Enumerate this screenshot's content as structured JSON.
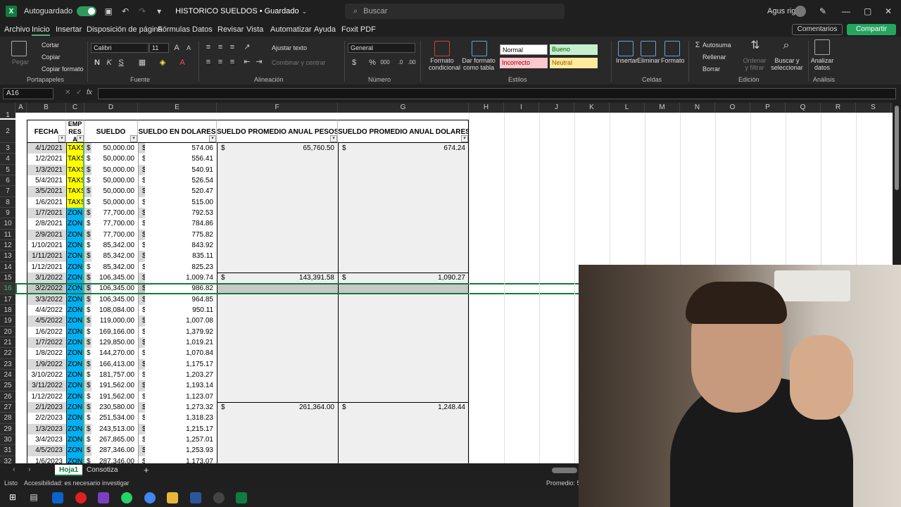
{
  "titlebar": {
    "autosave_label": "Autoguardado",
    "doc_title": "HISTORICO SUELDOS • Guardado",
    "search_placeholder": "Buscar",
    "user_name": "Agus riga"
  },
  "menu": {
    "items": [
      "Archivo",
      "Inicio",
      "Insertar",
      "Disposición de página",
      "Fórmulas",
      "Datos",
      "Revisar",
      "Vista",
      "Automatizar",
      "Ayuda",
      "Foxit PDF"
    ],
    "active": "Inicio",
    "comments": "Comentarios",
    "share": "Compartir"
  },
  "ribbon": {
    "clipboard": {
      "paste": "Pegar",
      "cut": "Cortar",
      "copy": "Copiar",
      "format_painter": "Copiar formato",
      "label": "Portapapeles"
    },
    "font": {
      "family": "Calibri",
      "size": "11",
      "bold": "N",
      "italic": "K",
      "underline": "S",
      "label": "Fuente"
    },
    "alignment": {
      "wrap": "Ajustar texto",
      "merge": "Combinar y centrar",
      "label": "Alineación"
    },
    "number": {
      "format": "General",
      "label": "Número"
    },
    "styles": {
      "cond_format": "Formato condicional",
      "table_format": "Dar formato como tabla",
      "normal": "Normal",
      "good": "Bueno",
      "bad": "Incorrecto",
      "neutral": "Neutral",
      "label": "Estilos"
    },
    "cells": {
      "insert": "Insertar",
      "delete": "Eliminar",
      "format": "Formato",
      "label": "Celdas"
    },
    "editing": {
      "autosum": "Autosuma",
      "fill": "Rellenar",
      "clear": "Borrar",
      "sort": "Ordenar y filtrar",
      "find": "Buscar y seleccionar",
      "label": "Edición"
    },
    "analysis": {
      "analyze": "Analizar datos",
      "label": "Análisis"
    }
  },
  "formula_bar": {
    "name_box": "A16",
    "fx": "fx",
    "content": ""
  },
  "columns": [
    "A",
    "B",
    "C",
    "D",
    "E",
    "F",
    "G",
    "H",
    "I",
    "J",
    "K",
    "L",
    "M",
    "N",
    "O",
    "P",
    "Q",
    "R",
    "S"
  ],
  "table": {
    "headers": {
      "fecha": "FECHA",
      "empresa_top": "EMP",
      "empresa_mid": "RES",
      "empresa_bot": "A",
      "sueldo": "SUELDO",
      "sueldo_usd": "SUELDO EN DOLARES",
      "prom_pesos": "SUELDO PROMEDIO ANUAL PESOS",
      "prom_usd": "SUELDO PROMEDIO ANUAL DOLARES"
    },
    "rows": [
      {
        "row": "3",
        "fecha": "4/1/2021",
        "emp": "TAXS",
        "sueldo": "50,000.00",
        "usd": "574.06",
        "prom_pesos": "65,760.50",
        "prom_usd": "674.24"
      },
      {
        "row": "4",
        "fecha": "1/2/2021",
        "emp": "TAXS",
        "sueldo": "50,000.00",
        "usd": "556.41"
      },
      {
        "row": "5",
        "fecha": "1/3/2021",
        "emp": "TAXS",
        "sueldo": "50,000.00",
        "usd": "540.91"
      },
      {
        "row": "6",
        "fecha": "5/4/2021",
        "emp": "TAXS",
        "sueldo": "50,000.00",
        "usd": "526.54"
      },
      {
        "row": "7",
        "fecha": "3/5/2021",
        "emp": "TAXS",
        "sueldo": "50,000.00",
        "usd": "520.47"
      },
      {
        "row": "8",
        "fecha": "1/6/2021",
        "emp": "TAXS",
        "sueldo": "50,000.00",
        "usd": "515.00"
      },
      {
        "row": "9",
        "fecha": "1/7/2021",
        "emp": "ZONI",
        "sueldo": "77,700.00",
        "usd": "792.53"
      },
      {
        "row": "10",
        "fecha": "2/8/2021",
        "emp": "ZONI",
        "sueldo": "77,700.00",
        "usd": "784.86"
      },
      {
        "row": "11",
        "fecha": "2/9/2021",
        "emp": "ZONI",
        "sueldo": "77,700.00",
        "usd": "775.82"
      },
      {
        "row": "12",
        "fecha": "1/10/2021",
        "emp": "ZONI",
        "sueldo": "85,342.00",
        "usd": "843.92"
      },
      {
        "row": "13",
        "fecha": "1/11/2021",
        "emp": "ZONI",
        "sueldo": "85,342.00",
        "usd": "835.11"
      },
      {
        "row": "14",
        "fecha": "1/12/2021",
        "emp": "ZONI",
        "sueldo": "85,342.00",
        "usd": "825.23"
      },
      {
        "row": "15",
        "fecha": "3/1/2022",
        "emp": "ZONI",
        "sueldo": "106,345.00",
        "usd": "1,009.74",
        "prom_pesos": "143,391.58",
        "prom_usd": "1,090.27"
      },
      {
        "row": "16",
        "fecha": "3/2/2022",
        "emp": "ZONI",
        "sueldo": "106,345.00",
        "usd": "986.82"
      },
      {
        "row": "17",
        "fecha": "3/3/2022",
        "emp": "ZONI",
        "sueldo": "106,345.00",
        "usd": "964.85"
      },
      {
        "row": "18",
        "fecha": "4/4/2022",
        "emp": "ZONI",
        "sueldo": "108,084.00",
        "usd": "950.11"
      },
      {
        "row": "19",
        "fecha": "4/5/2022",
        "emp": "ZONI",
        "sueldo": "119,000.00",
        "usd": "1,007.08"
      },
      {
        "row": "20",
        "fecha": "1/6/2022",
        "emp": "ZONI",
        "sueldo": "169,166.00",
        "usd": "1,379.92"
      },
      {
        "row": "21",
        "fecha": "1/7/2022",
        "emp": "ZONI",
        "sueldo": "129,850.00",
        "usd": "1,019.21"
      },
      {
        "row": "22",
        "fecha": "1/8/2022",
        "emp": "ZONI",
        "sueldo": "144,270.00",
        "usd": "1,070.84"
      },
      {
        "row": "23",
        "fecha": "1/9/2022",
        "emp": "ZONI",
        "sueldo": "166,413.00",
        "usd": "1,175.17"
      },
      {
        "row": "24",
        "fecha": "3/10/2022",
        "emp": "ZONI",
        "sueldo": "181,757.00",
        "usd": "1,203.27"
      },
      {
        "row": "25",
        "fecha": "3/11/2022",
        "emp": "ZONI",
        "sueldo": "191,562.00",
        "usd": "1,193.14"
      },
      {
        "row": "26",
        "fecha": "1/12/2022",
        "emp": "ZONI",
        "sueldo": "191,562.00",
        "usd": "1,123.07"
      },
      {
        "row": "27",
        "fecha": "2/1/2023",
        "emp": "ZONI",
        "sueldo": "230,580.00",
        "usd": "1,273.32",
        "prom_pesos": "261,364.00",
        "prom_usd": "1,248.44"
      },
      {
        "row": "28",
        "fecha": "2/2/2023",
        "emp": "ZONI",
        "sueldo": "251,534.00",
        "usd": "1,318.23"
      },
      {
        "row": "29",
        "fecha": "1/3/2023",
        "emp": "ZONI",
        "sueldo": "243,513.00",
        "usd": "1,215.17"
      },
      {
        "row": "30",
        "fecha": "3/4/2023",
        "emp": "ZONI",
        "sueldo": "267,865.00",
        "usd": "1,257.01"
      },
      {
        "row": "31",
        "fecha": "4/5/2023",
        "emp": "ZONI",
        "sueldo": "287,346.00",
        "usd": "1,253.93"
      },
      {
        "row": "32",
        "fecha": "1/6/2023",
        "emp": "ZONI",
        "sueldo": "287,346.00",
        "usd": "1,173.07"
      }
    ],
    "currency_symbol": "$"
  },
  "sheet_tabs": {
    "tabs": [
      "Hoja1",
      "Consotiza"
    ],
    "active": "Hoja1",
    "add": "+"
  },
  "statusbar": {
    "ready": "Listo",
    "accessibility": "Accesibilidad: es necesario investigar",
    "average": "Promedio: 50"
  },
  "colors": {
    "excel_green": "#107c41",
    "taxs_yellow": "#ffff00",
    "zoni_cyan": "#00b0f0",
    "band_gray": "#d9d9d9",
    "selection_green": "#4fb47a"
  },
  "icons": [
    "excel-icon",
    "save-icon",
    "undo-icon",
    "redo-icon",
    "search-icon",
    "pen-icon",
    "minimize-icon",
    "restore-icon",
    "close-icon"
  ]
}
